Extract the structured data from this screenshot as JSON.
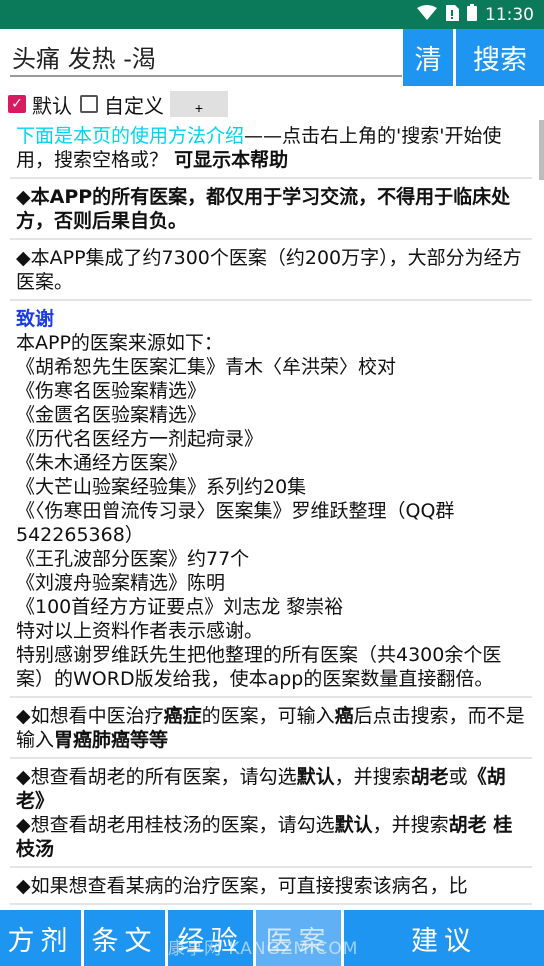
{
  "status_bar": {
    "time": "11:30",
    "wifi_icon": "wifi-icon",
    "battery_icon": "battery-icon"
  },
  "search": {
    "value": "头痛 发热 -渴",
    "clear_label": "清",
    "search_label": "搜索"
  },
  "options": {
    "default_label": "默认",
    "default_checked": true,
    "custom_label": "自定义",
    "custom_checked": false,
    "small_btn_label": "+"
  },
  "content": {
    "intro_cyan": "下面是本页的使用方法介绍",
    "intro_rest": "——点击右上角的'搜索'开始使用，搜索空格或？",
    "intro_bold": "可显示本帮助",
    "disclaimer": "◆本APP的所有医案，都仅用于学习交流，不得用于临床处方，否则后果自负。",
    "summary": "◆本APP集成了约7300个医案（约200万字），大部分为经方医案。",
    "thanks_title": "致谢",
    "thanks_lines": [
      "本APP的医案来源如下：",
      "《胡希恕先生医案汇集》青木〈牟洪荣〉校对",
      "《伤寒名医验案精选》",
      "《金匮名医验案精选》",
      "《历代名医经方一剂起疴录》",
      "《朱木通经方医案》",
      "《大芒山验案经验集》系列约20集",
      "《〈伤寒田曾流传习录〉医案集》罗维跃整理（QQ群542265368）",
      "《王孔波部分医案》约77个",
      "《刘渡舟验案精选》陈明",
      "《100首经方方证要点》刘志龙 黎崇裕",
      "特对以上资料作者表示感谢。",
      "特别感谢罗维跃先生把他整理的所有医案（共4300余个医案）的WORD版发给我，使本app的医案数量直接翻倍。"
    ],
    "tip1": {
      "a": "◆如想看中医治疗",
      "b": "癌症",
      "c": "的医案，可输入",
      "d": "癌",
      "e": "后点击搜索，而不是输入",
      "f": "胃癌肺癌等等"
    },
    "tip2": {
      "a": "◆想查看胡老的所有医案，请勾选",
      "b": "默认",
      "c": "，并搜索",
      "d": "胡老",
      "e": "或",
      "f": "《胡老》"
    },
    "tip3": {
      "a": "◆想查看胡老用桂枝汤的医案，请勾选",
      "b": "默认",
      "c": "，并搜索",
      "d": "胡老 桂枝汤"
    },
    "tip4": "◆如果想查看某病的治疗医案，可直接搜索该病名，比"
  },
  "bottom_nav": {
    "items": [
      "方剂",
      "条文",
      "经验",
      "医案",
      "建议"
    ],
    "disabled_index": 3
  },
  "watermark": "康享网 KANGZM.COM",
  "colors": {
    "accent": "#1f95f2",
    "status_bar": "#0a7a5a",
    "checkbox": "#d81b60",
    "cyan_text": "#00d4f0",
    "blue_heading": "#1b3de6"
  }
}
